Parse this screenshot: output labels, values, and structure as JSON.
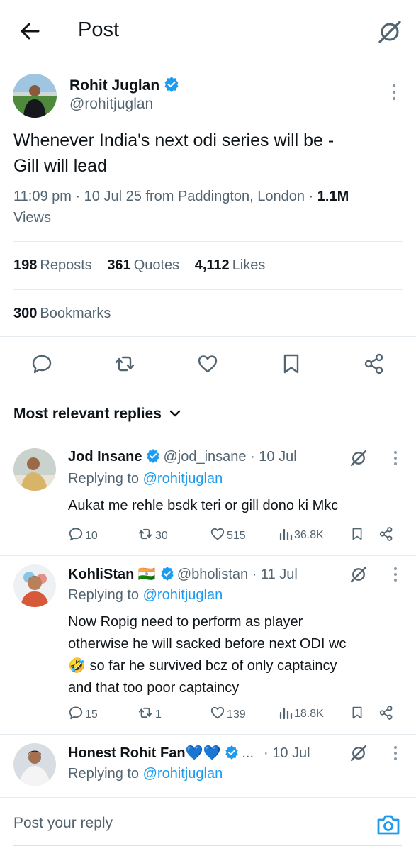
{
  "header": {
    "title": "Post"
  },
  "post": {
    "author_name": "Rohit Juglan",
    "author_handle": "@rohitjuglan",
    "text_line1": "Whenever India's next odi series will be -",
    "text_line2": "Gill will lead",
    "meta_prefix": "11:09 pm · 10 Jul 25 from Paddington, London · ",
    "views_count": "1.1M",
    "views_label": "Views",
    "reposts_count": "198",
    "reposts_label": "Reposts",
    "quotes_count": "361",
    "quotes_label": "Quotes",
    "likes_count": "4,112",
    "likes_label": "Likes",
    "bookmarks_count": "300",
    "bookmarks_label": "Bookmarks"
  },
  "section": {
    "title": "Most relevant replies"
  },
  "replies": [
    {
      "name": "Jod Insane",
      "handle": "@jod_insane · 10 Jul",
      "replying_prefix": "Replying to ",
      "mention": "@rohitjuglan",
      "text": "Aukat me rehle bsdk teri or gill dono ki Mkc",
      "reply_count": "10",
      "repost_count": "30",
      "like_count": "515",
      "view_count": "36.8K"
    },
    {
      "name": "KohliStan",
      "flag": "🇮🇳",
      "handle": "@bholistan · 11 Jul",
      "replying_prefix": "Replying to ",
      "mention": "@rohitjuglan",
      "text_line1": "Now Ropig need to perform as player",
      "text_line2": "otherwise he will sacked before next ODI wc",
      "text_line3_emoji": "🤣",
      "text_line3": " so far he survived bcz of only captaincy",
      "text_line4": "and that too poor captaincy",
      "reply_count": "15",
      "repost_count": "1",
      "like_count": "139",
      "view_count": "18.8K"
    },
    {
      "name": "Honest Rohit Fan",
      "hearts": "💙💙",
      "ellipsis": "...",
      "date": "· 10 Jul",
      "replying_prefix": "Replying to ",
      "mention": "@rohitjuglan"
    }
  ],
  "reply_bar": {
    "placeholder": "Post your reply"
  },
  "colors": {
    "accent": "#1d9bf0",
    "secondary_text": "#536471",
    "border": "#e6ecf0"
  }
}
